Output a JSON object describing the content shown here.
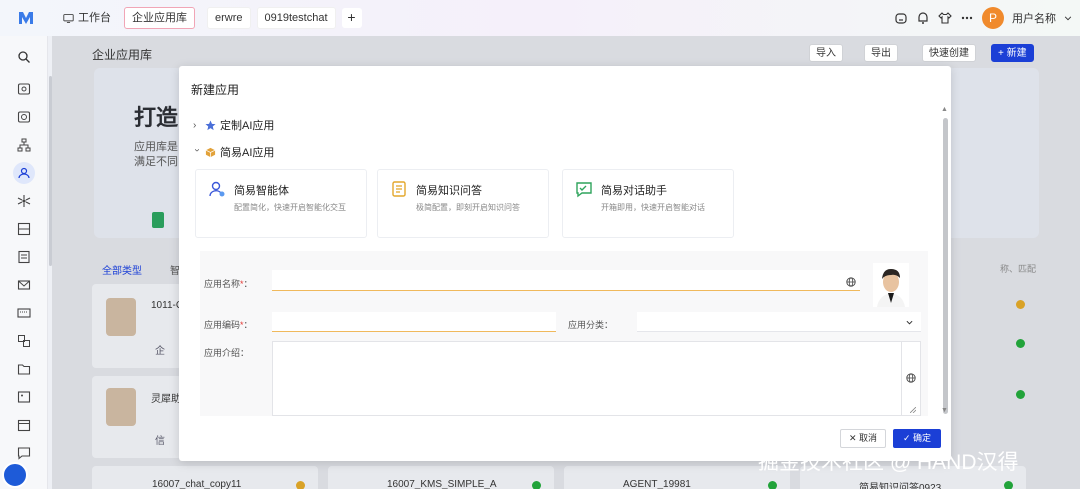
{
  "topbar": {
    "tabs": [
      {
        "label": "工作台"
      },
      {
        "label": "企业应用库"
      },
      {
        "label": "erwre"
      },
      {
        "label": "0919testchat"
      }
    ],
    "add_tab": "+",
    "avatar_letter": "P",
    "username": "用户名称"
  },
  "page": {
    "title": "企业应用库",
    "buttons": {
      "import": "导入",
      "export": "导出",
      "quick_create": "快速创建",
      "new": "+ 新建"
    },
    "banner_title": "打造",
    "banner_line1": "应用库是",
    "banner_line2": "满足不同",
    "filter_all": "全部类型",
    "filter_next": "智",
    "cards": [
      {
        "name": "1011-C"
      },
      {
        "name": "灵犀助"
      },
      {
        "name": "16007_chat_copy11"
      },
      {
        "name": "16007_KMS_SIMPLE_A"
      },
      {
        "name": "AGENT_19981"
      },
      {
        "name": "简易知识问答0923"
      }
    ],
    "card_tags": [
      "企",
      "信"
    ],
    "search_hint": "称、匹配"
  },
  "modal": {
    "title": "新建应用",
    "groups": [
      {
        "label": "定制AI应用",
        "expanded": false
      },
      {
        "label": "简易AI应用",
        "expanded": true
      }
    ],
    "app_types": [
      {
        "name": "简易智能体",
        "desc": "配置简化，快速开启智能化交互"
      },
      {
        "name": "简易知识问答",
        "desc": "极简配置，即刻开启知识问答"
      },
      {
        "name": "简易对话助手",
        "desc": "开箱即用，快速开启智能对话"
      }
    ],
    "form": {
      "app_name_label": "应用名称",
      "app_code_label": "应用编码",
      "category_label": "应用分类：",
      "intro_label": "应用介绍：",
      "required_mark": "*",
      "colon": "："
    },
    "buttons": {
      "cancel": "取消",
      "confirm": "确定"
    }
  },
  "watermark": "掘金技术社区 @ HAND汉得",
  "colors": {
    "primary": "#1b3fd6",
    "warning": "#f0b95c",
    "required": "#e53935",
    "avatar": "#f08a2c",
    "success": "#22a33a"
  }
}
